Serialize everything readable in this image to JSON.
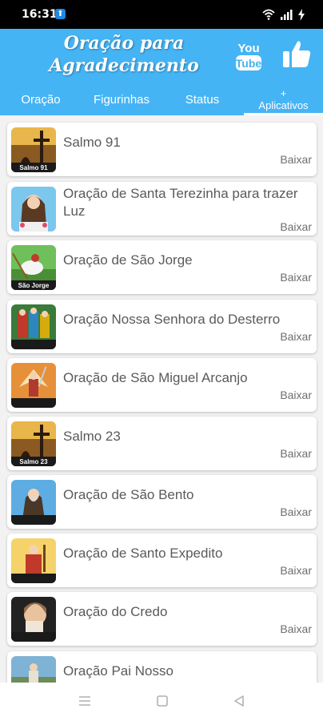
{
  "status_bar": {
    "time": "16:31"
  },
  "header": {
    "title_line1": "Oração para",
    "title_line2": "Agradecimento",
    "youtube_text_top": "You",
    "youtube_text_bottom": "Tube",
    "colors": {
      "primary": "#45b4f5",
      "text": "#ffffff"
    }
  },
  "tabs": [
    {
      "label": "Oração"
    },
    {
      "label": "Figurinhas"
    },
    {
      "label": "Status"
    },
    {
      "label_top": "+",
      "label_bottom": "Aplicativos",
      "active": true
    }
  ],
  "action_label": "Baixar",
  "items": [
    {
      "title": "Salmo 91",
      "thumb_caption": "Salmo 91"
    },
    {
      "title": "Oração de Santa Terezinha para trazer Luz"
    },
    {
      "title": "Oração de São Jorge",
      "thumb_caption": "São Jorge"
    },
    {
      "title": "Oração Nossa Senhora do Desterro"
    },
    {
      "title": "Oração de São Miguel Arcanjo"
    },
    {
      "title": "Salmo 23",
      "thumb_caption": "Salmo 23"
    },
    {
      "title": "Oração de São Bento"
    },
    {
      "title": "Oração de Santo Expedito"
    },
    {
      "title": "Oração do Credo"
    },
    {
      "title": "Oração Pai Nosso"
    }
  ]
}
